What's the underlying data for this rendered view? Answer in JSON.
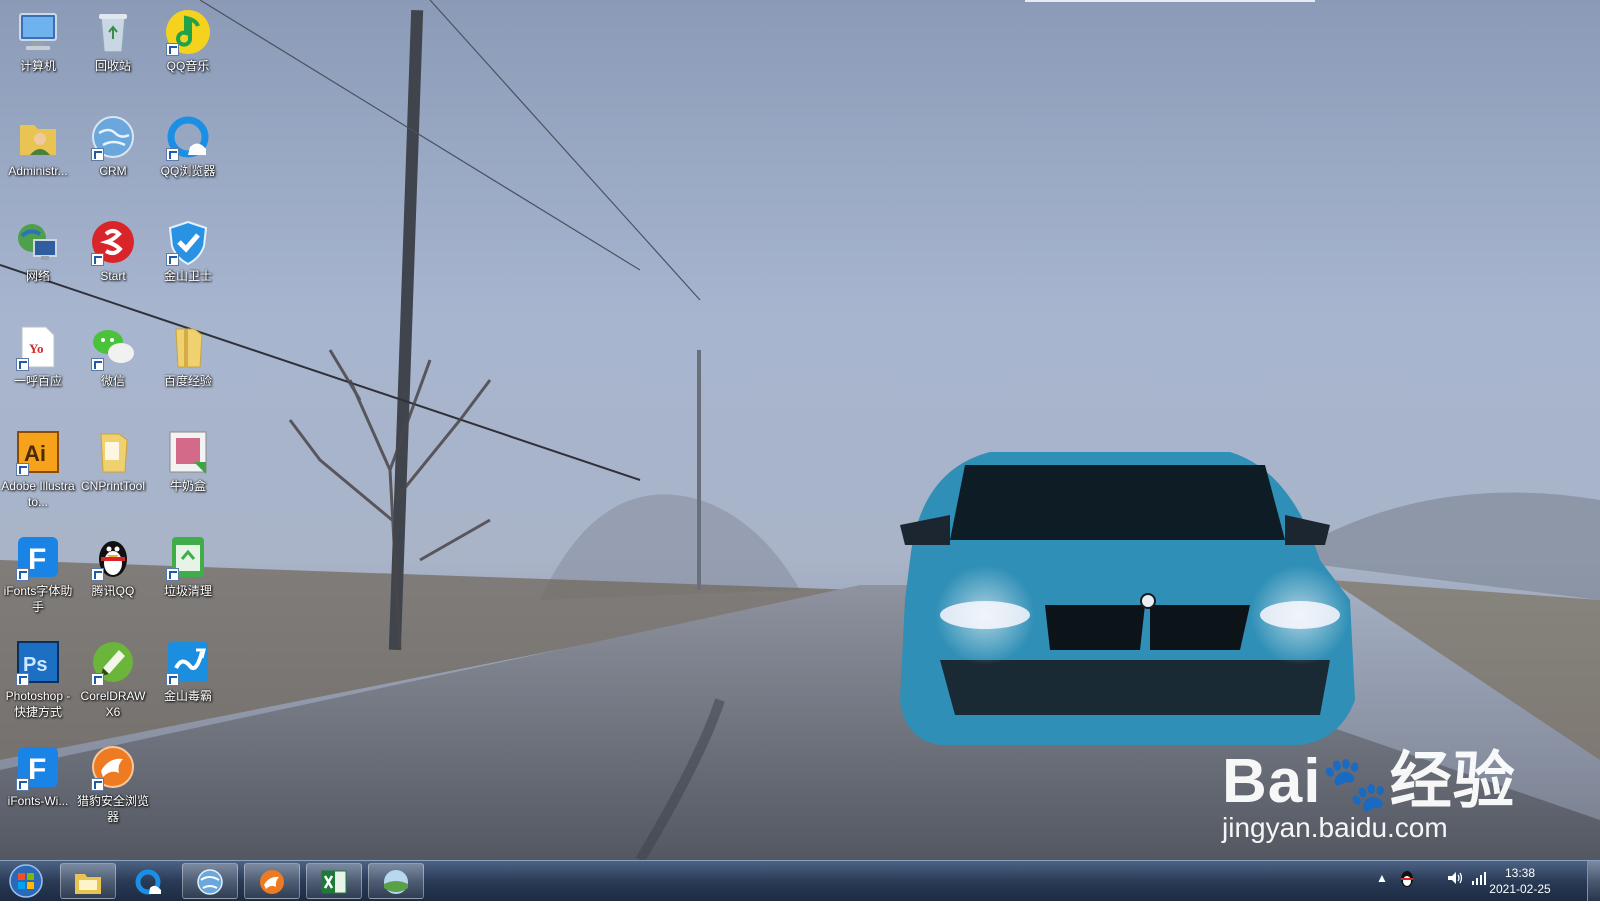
{
  "desktop": {
    "icons": [
      {
        "label": "计算机",
        "icon": "computer-icon"
      },
      {
        "label": "回收站",
        "icon": "recycle-bin-icon"
      },
      {
        "label": "QQ音乐",
        "icon": "qq-music-icon"
      },
      {
        "label": "Administr...",
        "icon": "user-folder-icon"
      },
      {
        "label": "CRM",
        "icon": "globe-icon"
      },
      {
        "label": "QQ浏览器",
        "icon": "qq-browser-icon"
      },
      {
        "label": "网络",
        "icon": "network-icon"
      },
      {
        "label": "Start",
        "icon": "start-app-icon"
      },
      {
        "label": "金山卫士",
        "icon": "shield-icon"
      },
      {
        "label": "一呼百应",
        "icon": "yo-document-icon"
      },
      {
        "label": "微信",
        "icon": "wechat-icon"
      },
      {
        "label": "百度经验",
        "icon": "folder-icon"
      },
      {
        "label": "Adobe Illustrato...",
        "icon": "illustrator-icon"
      },
      {
        "label": "CNPrintTool",
        "icon": "folder-icon"
      },
      {
        "label": "牛奶盒",
        "icon": "milk-box-icon"
      },
      {
        "label": "iFonts字体助手",
        "icon": "ifonts-icon"
      },
      {
        "label": "腾讯QQ",
        "icon": "qq-penguin-icon"
      },
      {
        "label": "垃圾清理",
        "icon": "trash-clean-icon"
      },
      {
        "label": "Photoshop - 快捷方式",
        "icon": "photoshop-icon"
      },
      {
        "label": "CorelDRAW X6",
        "icon": "coreldraw-icon"
      },
      {
        "label": "金山毒霸",
        "icon": "antivirus-icon"
      },
      {
        "label": "iFonts-Wi...",
        "icon": "ifonts-icon"
      },
      {
        "label": "猎豹安全浏览器",
        "icon": "cheetah-browser-icon"
      }
    ]
  },
  "watermark": {
    "brand": "Bai",
    "brand_suffix": "经验",
    "url": "jingyan.baidu.com"
  },
  "taskbar": {
    "buttons": [
      {
        "name": "explorer",
        "icon": "folder-explorer-icon"
      },
      {
        "name": "qq-browser",
        "icon": "qq-browser-icon"
      },
      {
        "name": "ie",
        "icon": "globe-icon"
      },
      {
        "name": "cheetah",
        "icon": "cheetah-browser-icon"
      },
      {
        "name": "excel",
        "icon": "excel-icon"
      },
      {
        "name": "photo-viewer",
        "icon": "photo-viewer-icon"
      }
    ],
    "clock": {
      "time": "13:38",
      "date": "2021-02-25"
    }
  }
}
